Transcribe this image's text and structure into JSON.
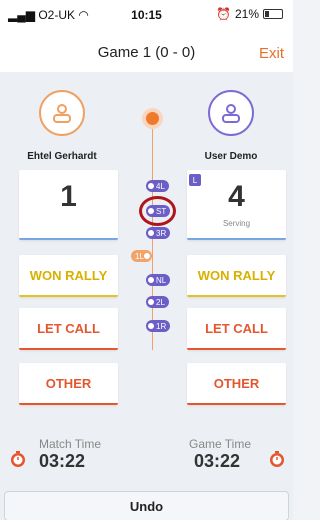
{
  "status_bar": {
    "carrier": "O2-UK",
    "time": "10:15",
    "battery": "21%"
  },
  "header": {
    "title": "Game 1 (0 - 0)",
    "exit_label": "Exit"
  },
  "players": {
    "left": {
      "name": "Ehtel Gerhardt",
      "score": "1"
    },
    "right": {
      "name": "User Demo",
      "score": "4",
      "status": "Serving",
      "badge": "L"
    }
  },
  "timeline": {
    "pills": [
      "4L",
      "ST",
      "3R",
      "1L",
      "NL",
      "2L",
      "1R"
    ]
  },
  "buttons": {
    "won_rally": "WON RALLY",
    "let_call": "LET CALL",
    "other": "OTHER",
    "undo": "Undo"
  },
  "timers": {
    "match_label": "Match Time",
    "match_value": "03:22",
    "game_label": "Game Time",
    "game_value": "03:22"
  },
  "colors": {
    "accent_orange": "#e8702a",
    "player_right": "#7c6ad6",
    "player_left": "#f0a060",
    "won": "#d8b100",
    "let": "#e4572e",
    "highlight": "#b0141b"
  }
}
